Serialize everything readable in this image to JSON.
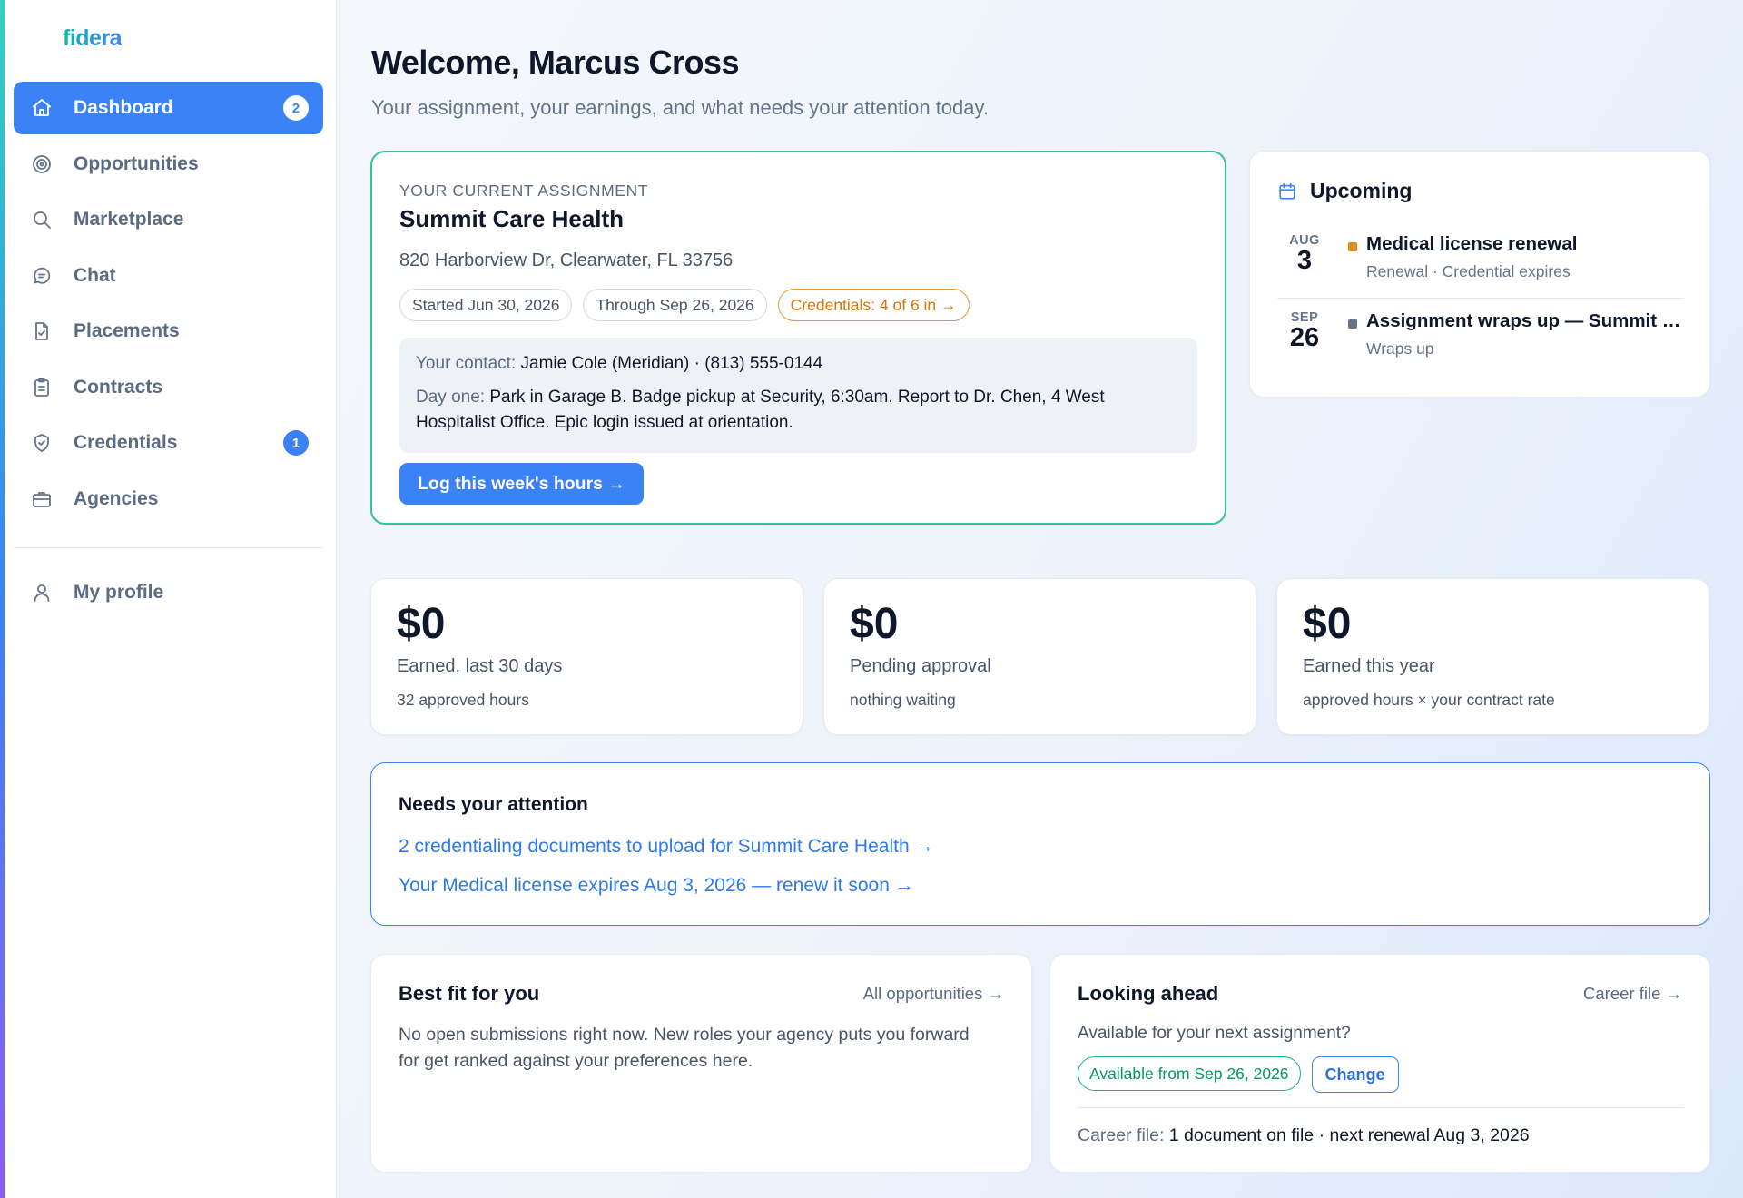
{
  "app": {
    "logo": "fidera"
  },
  "sidebar": {
    "items": [
      {
        "label": "Dashboard",
        "icon": "home-icon",
        "active": true,
        "badge": "2"
      },
      {
        "label": "Opportunities",
        "icon": "target-icon"
      },
      {
        "label": "Marketplace",
        "icon": "search-icon"
      },
      {
        "label": "Chat",
        "icon": "chat-icon"
      },
      {
        "label": "Placements",
        "icon": "document-check-icon"
      },
      {
        "label": "Contracts",
        "icon": "clipboard-icon"
      },
      {
        "label": "Credentials",
        "icon": "shield-check-icon",
        "badge": "1"
      },
      {
        "label": "Agencies",
        "icon": "briefcase-icon"
      }
    ],
    "profile": {
      "label": "My profile",
      "icon": "user-icon"
    }
  },
  "header": {
    "title": "Welcome, Marcus Cross",
    "subtitle": "Your assignment, your earnings, and what needs your attention today."
  },
  "assignment": {
    "eyebrow": "YOUR CURRENT ASSIGNMENT",
    "facility": "Summit Care Health",
    "address": "820 Harborview Dr, Clearwater, FL 33756",
    "chips": {
      "started": "Started Jun 30, 2026",
      "through": "Through Sep 26, 2026",
      "credentials": "Credentials: 4 of 6 in →"
    },
    "contact_label": "Your contact:",
    "contact_value": "Jamie Cole (Meridian) · (813) 555-0144",
    "dayone_label": "Day one:",
    "dayone_value": "Park in Garage B. Badge pickup at Security, 6:30am. Report to Dr. Chen, 4 West Hospitalist Office. Epic login issued at orientation.",
    "log_button": "Log this week's hours →"
  },
  "upcoming": {
    "title": "Upcoming",
    "events": [
      {
        "month": "AUG",
        "day": "3",
        "title": "Medical license renewal",
        "sub": "Renewal · Credential expires",
        "dot_color": "#e08a1e"
      },
      {
        "month": "SEP",
        "day": "26",
        "title": "Assignment wraps up — Summit Care Health",
        "sub": "Wraps up",
        "dot_color": "#64748b"
      }
    ]
  },
  "stats": [
    {
      "value": "$0",
      "label": "Earned, last 30 days",
      "sub": "32 approved hours"
    },
    {
      "value": "$0",
      "label": "Pending approval",
      "sub": "nothing waiting"
    },
    {
      "value": "$0",
      "label": "Earned this year",
      "sub": "approved hours × your contract rate"
    }
  ],
  "attention": {
    "title": "Needs your attention",
    "links": [
      "2 credentialing documents to upload for Summit Care Health →",
      "Your Medical license expires Aug 3, 2026 — renew it soon →"
    ]
  },
  "best_fit": {
    "title": "Best fit for you",
    "link": "All opportunities →",
    "body": "No open submissions right now. New roles your agency puts you forward for get ranked against your preferences here."
  },
  "looking_ahead": {
    "title": "Looking ahead",
    "link": "Career file →",
    "question": "Available for your next assignment?",
    "availability": "Available from Sep 26, 2026",
    "change_button": "Change",
    "career_label": "Career file:",
    "career_value": "1 document on file · next renewal Aug 3, 2026"
  },
  "colors": {
    "accent": "#3b82f6",
    "success": "#10b981",
    "warning": "#d97706"
  }
}
